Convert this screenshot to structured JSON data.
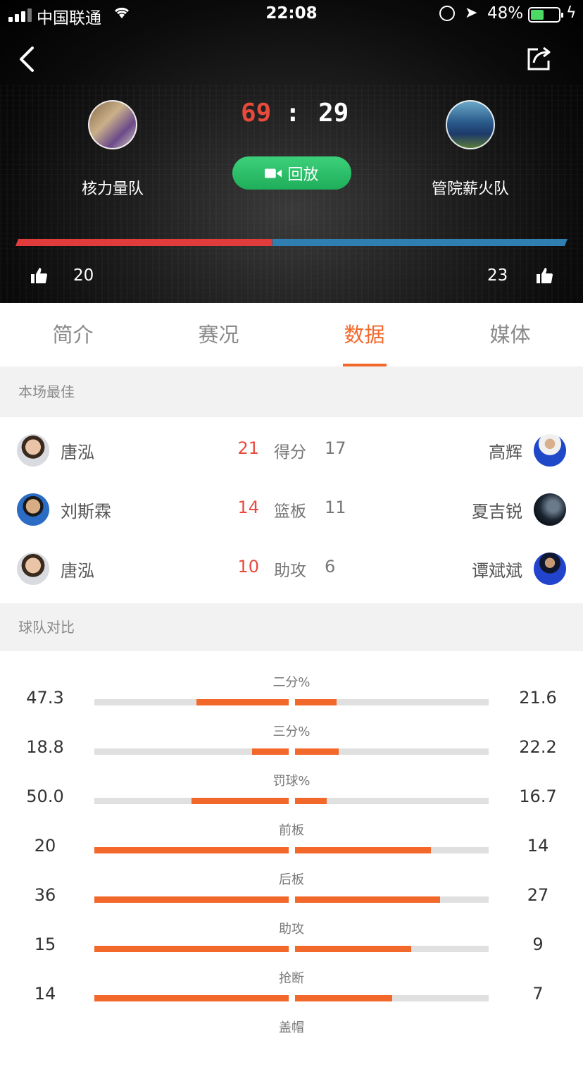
{
  "status_bar": {
    "carrier": "中国联通",
    "time": "22:08",
    "battery": "48%",
    "battery_level": 0.48
  },
  "match": {
    "home_team": "核力量队",
    "away_team": "管院薪火队",
    "home_score": "69",
    "score_separator": ":",
    "away_score": "29",
    "replay_label": "回放",
    "home_likes": "20",
    "away_likes": "23",
    "home_support_fraction": 0.465,
    "colors": {
      "home": "#e23b3b",
      "away": "#2f7fb0",
      "replay": "#2ec06a",
      "accent": "#f2682b"
    }
  },
  "tabs": [
    {
      "label": "简介",
      "active": false
    },
    {
      "label": "赛况",
      "active": false
    },
    {
      "label": "数据",
      "active": true
    },
    {
      "label": "媒体",
      "active": false
    }
  ],
  "best": {
    "header": "本场最佳",
    "rows": [
      {
        "left_player": "唐泓",
        "left_value": "21",
        "label": "得分",
        "right_value": "17",
        "right_player": "高辉"
      },
      {
        "left_player": "刘斯霖",
        "left_value": "14",
        "label": "篮板",
        "right_value": "11",
        "right_player": "夏吉锐"
      },
      {
        "left_player": "唐泓",
        "left_value": "10",
        "label": "助攻",
        "right_value": "6",
        "right_player": "谭斌斌"
      }
    ]
  },
  "compare": {
    "header": "球队对比",
    "rows": [
      {
        "label": "二分%",
        "left": "47.3",
        "right": "21.6",
        "left_fill": 0.475,
        "right_fill": 0.215
      },
      {
        "label": "三分%",
        "left": "18.8",
        "right": "22.2",
        "left_fill": 0.19,
        "right_fill": 0.225
      },
      {
        "label": "罚球%",
        "left": "50.0",
        "right": "16.7",
        "left_fill": 0.5,
        "right_fill": 0.165
      },
      {
        "label": "前板",
        "left": "20",
        "right": "14",
        "left_fill": 1.0,
        "right_fill": 0.7
      },
      {
        "label": "后板",
        "left": "36",
        "right": "27",
        "left_fill": 1.0,
        "right_fill": 0.75
      },
      {
        "label": "助攻",
        "left": "15",
        "right": "9",
        "left_fill": 1.0,
        "right_fill": 0.6
      },
      {
        "label": "抢断",
        "left": "14",
        "right": "7",
        "left_fill": 1.0,
        "right_fill": 0.5
      },
      {
        "label": "盖帽"
      }
    ]
  }
}
